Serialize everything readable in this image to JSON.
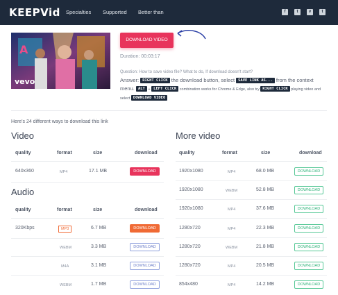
{
  "header": {
    "logo": "KEEPVid",
    "nav": [
      "Specialties",
      "Supported",
      "Better than"
    ],
    "social_icons": [
      "facebook-icon",
      "twitter-icon",
      "vk-icon",
      "tumblr-icon"
    ]
  },
  "video": {
    "watermark": "vevo",
    "download_button": "DOWNLOAD VIDEO",
    "duration": "Duration: 00:03:17",
    "question": "Question: How to save video file? What to do, If download doesn't start?",
    "answer_parts": {
      "a1": "Answer: ",
      "k1": "RIGHT CLICK",
      "a2": " the download button, select ",
      "k2": "SAVE LINK AS...",
      "a3": " from the context menu. ",
      "k3": "ALT",
      "a4": " + ",
      "k4": "LEFT CLICK",
      "a5": " combination works for Chrome & Edge, also try ",
      "k5": "RIGHT CLICK",
      "a6": " playing video and select ",
      "k6": "DOWNLOAD VIDEO"
    }
  },
  "ways_text": "Here's 24 different ways to download this link",
  "video_section": {
    "title": "Video",
    "headers": {
      "quality": "quality",
      "format": "format",
      "size": "size",
      "download": "download"
    },
    "rows": [
      {
        "quality": "640x360",
        "format": "MP4",
        "size": "17.1 MB",
        "button": "DOWNLOAD"
      }
    ]
  },
  "audio_section": {
    "title": "Audio",
    "headers": {
      "quality": "quality",
      "format": "format",
      "size": "size",
      "download": "download"
    },
    "rows": [
      {
        "quality": "320Kbps",
        "format": "MP3",
        "size": "6.7 MB",
        "button": "DOWNLOAD"
      },
      {
        "quality": "",
        "format": "WEBM",
        "size": "3.3 MB",
        "button": "DOWNLOAD"
      },
      {
        "quality": "",
        "format": "M4A",
        "size": "3.1 MB",
        "button": "DOWNLOAD"
      },
      {
        "quality": "",
        "format": "WEBM",
        "size": "1.7 MB",
        "button": "DOWNLOAD"
      }
    ]
  },
  "more_section": {
    "title": "More video",
    "headers": {
      "quality": "quality",
      "format": "format",
      "size": "size",
      "download": "download"
    },
    "rows": [
      {
        "quality": "1920x1080",
        "format": "MP4",
        "size": "68.0 MB",
        "button": "DOWNLOAD"
      },
      {
        "quality": "1920x1080",
        "format": "WEBM",
        "size": "52.8 MB",
        "button": "DOWNLOAD"
      },
      {
        "quality": "1920x1080",
        "format": "MP4",
        "size": "37.6 MB",
        "button": "DOWNLOAD"
      },
      {
        "quality": "1280x720",
        "format": "MP4",
        "size": "22.3 MB",
        "button": "DOWNLOAD"
      },
      {
        "quality": "1280x720",
        "format": "WEBM",
        "size": "21.8 MB",
        "button": "DOWNLOAD"
      },
      {
        "quality": "1280x720",
        "format": "MP4",
        "size": "20.5 MB",
        "button": "DOWNLOAD"
      },
      {
        "quality": "854x480",
        "format": "MP4",
        "size": "14.2 MB",
        "button": "DOWNLOAD"
      }
    ]
  },
  "colors": {
    "header_bg": "#1e2a3b",
    "accent_red": "#e8345c",
    "accent_orange": "#f06a35",
    "accent_green": "#2fb37a",
    "accent_blue": "#6d7fc8"
  }
}
